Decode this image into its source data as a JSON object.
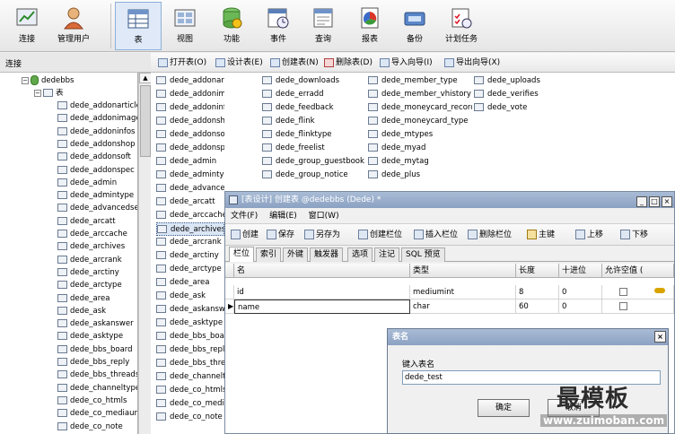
{
  "toolbar": {
    "buttons": [
      {
        "label": "连接",
        "icon": "connect-icon"
      },
      {
        "label": "管理用户",
        "icon": "user-icon"
      },
      {
        "label": "表",
        "icon": "table-icon"
      },
      {
        "label": "视图",
        "icon": "view-icon"
      },
      {
        "label": "功能",
        "icon": "function-icon"
      },
      {
        "label": "事件",
        "icon": "event-icon"
      },
      {
        "label": "查询",
        "icon": "query-icon"
      },
      {
        "label": "报表",
        "icon": "report-icon"
      },
      {
        "label": "备份",
        "icon": "backup-icon"
      },
      {
        "label": "计划任务",
        "icon": "schedule-icon"
      }
    ]
  },
  "left_panel": {
    "header": "连接",
    "db_name": "dedebbs",
    "table_group": "表",
    "tables": [
      "dede_addonarticle",
      "dede_addonimages",
      "dede_addoninfos",
      "dede_addonshop",
      "dede_addonsoft",
      "dede_addonspec",
      "dede_admin",
      "dede_admintype",
      "dede_advancedsea",
      "dede_arcatt",
      "dede_arccache",
      "dede_archives",
      "dede_arcrank",
      "dede_arctiny",
      "dede_arctype",
      "dede_area",
      "dede_ask",
      "dede_askanswer",
      "dede_asktype",
      "dede_bbs_board",
      "dede_bbs_reply",
      "dede_bbs_threads",
      "dede_channeltype",
      "dede_co_htmls",
      "dede_co_mediaurls",
      "dede_co_note"
    ]
  },
  "object_toolbar": {
    "open": "打开表(O)",
    "design": "设计表(E)",
    "create": "创建表(N)",
    "delete": "删除表(D)",
    "import": "导入向导(I)",
    "export": "导出向导(X)"
  },
  "main_list": {
    "col1": [
      "dede_addonarticle",
      "dede_addonimages",
      "dede_addoninfos",
      "dede_addonshop",
      "dede_addonsoft",
      "dede_addonspec",
      "dede_admin",
      "dede_admintype",
      "dede_advancedsearch",
      "dede_arcatt",
      "dede_arccache",
      "dede_archives",
      "dede_arcrank",
      "dede_arctiny",
      "dede_arctype",
      "dede_area",
      "dede_ask",
      "dede_askanswer",
      "dede_asktype",
      "dede_bbs_board",
      "dede_bbs_reply",
      "dede_bbs_threads",
      "dede_channeltype",
      "dede_co_htmls",
      "dede_co_mediaurls",
      "dede_co_note"
    ],
    "col2": [
      "dede_downloads",
      "dede_erradd",
      "dede_feedback",
      "dede_flink",
      "dede_flinktype",
      "dede_freelist",
      "dede_group_guestbook",
      "dede_group_notice"
    ],
    "col3": [
      "dede_member_type",
      "dede_member_vhistory",
      "dede_moneycard_record",
      "dede_moneycard_type",
      "dede_mtypes",
      "dede_myad",
      "dede_mytag",
      "dede_plus"
    ],
    "col4": [
      "dede_uploads",
      "dede_verifies",
      "dede_vote"
    ]
  },
  "design_window": {
    "title": "[表设计] 创建表 @dedebbs (Dede) *",
    "menu": [
      "文件(F)",
      "编辑(E)",
      "窗口(W)"
    ],
    "tools": [
      "创建",
      "保存",
      "另存为",
      "创建栏位",
      "插入栏位",
      "删除栏位",
      "主键",
      "上移",
      "下移"
    ],
    "tabs": [
      "栏位",
      "索引",
      "外键",
      "触发器",
      "选项",
      "注记",
      "SQL 预览"
    ],
    "columns": [
      "名",
      "类型",
      "长度",
      "十进位",
      "允许空值 ("
    ],
    "rows": [
      {
        "name": "id",
        "type": "mediumint",
        "length": "8",
        "decimals": "0"
      },
      {
        "name": "name",
        "type": "char",
        "length": "60",
        "decimals": "0"
      }
    ]
  },
  "dialog": {
    "title": "表名",
    "label": "键入表名",
    "value": "dede_test",
    "ok": "确定",
    "cancel": "取消"
  },
  "watermark": {
    "text": "最模板",
    "url": "www.zuimoban.com"
  }
}
